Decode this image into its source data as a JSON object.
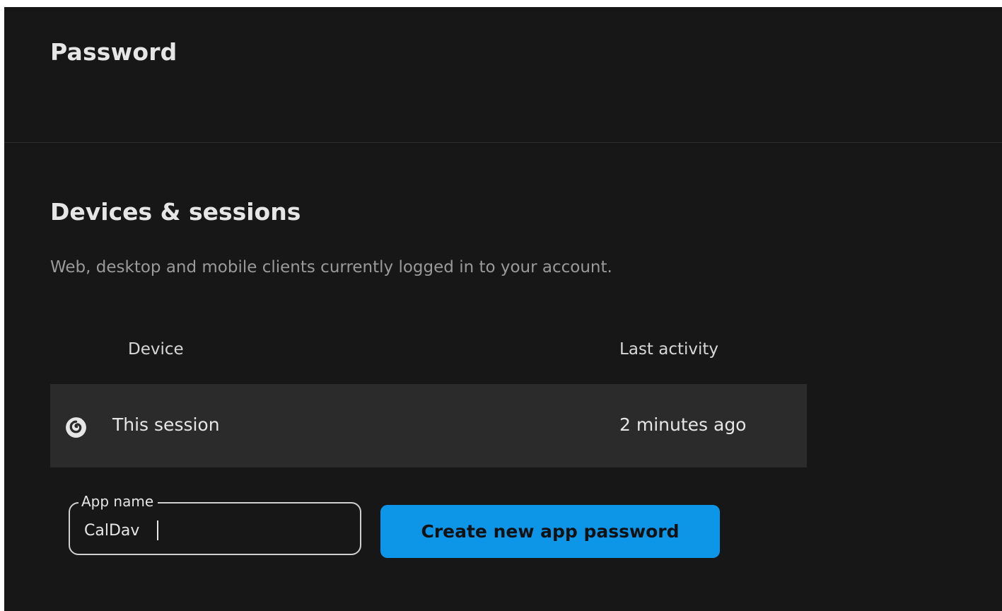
{
  "password_section": {
    "title": "Password"
  },
  "devices_section": {
    "title": "Devices & sessions",
    "description": "Web, desktop and mobile clients currently logged in to your account.",
    "columns": {
      "device": "Device",
      "last_activity": "Last activity"
    },
    "sessions": [
      {
        "icon": "firefox-icon",
        "name": "This session",
        "last_activity": "2 minutes ago"
      }
    ]
  },
  "app_password": {
    "field_label": "App name",
    "field_value": "CalDav",
    "button_label": "Create new app password"
  },
  "colors": {
    "panel_background": "#171717",
    "row_background": "#2b2b2b",
    "primary_button": "#0d95e8"
  }
}
